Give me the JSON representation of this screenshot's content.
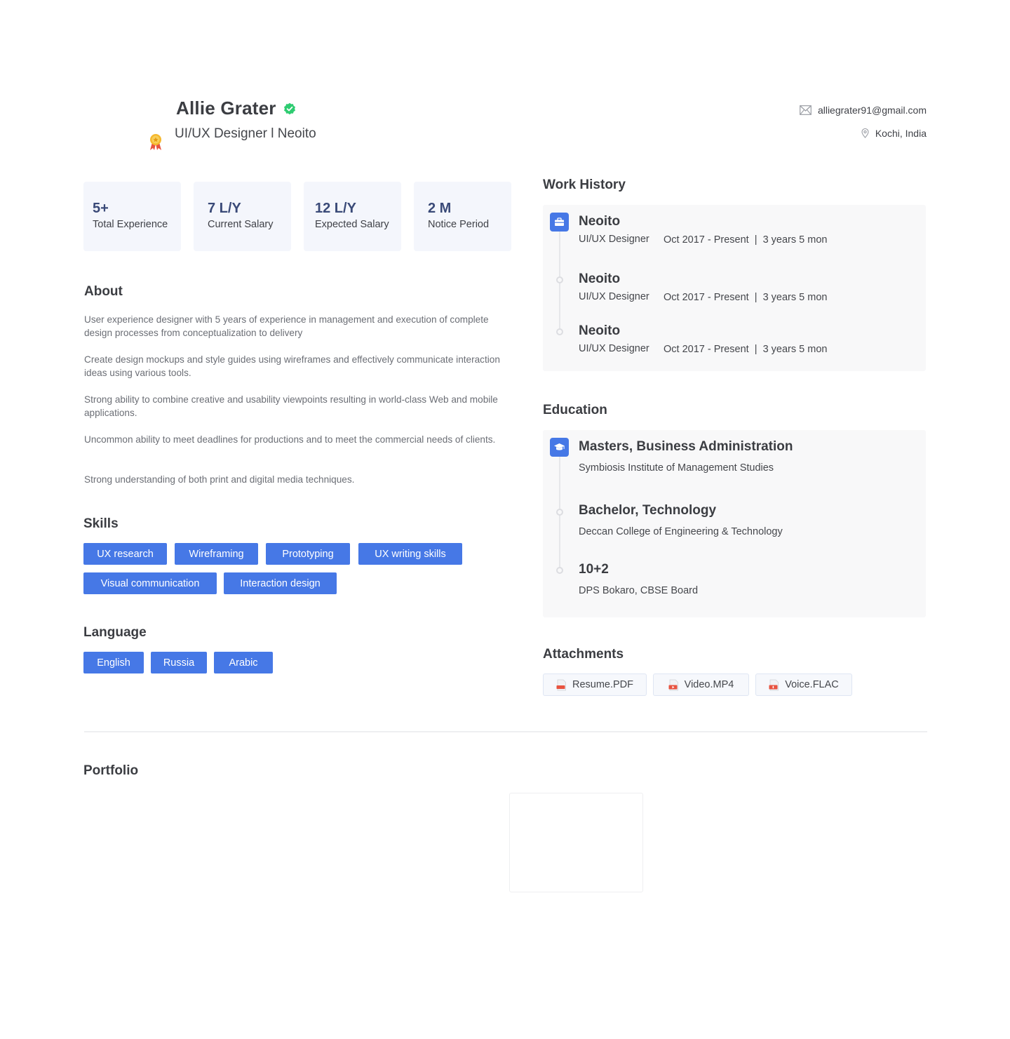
{
  "profile": {
    "name": "Allie Grater",
    "role": "UI/UX Designer l Neoito",
    "email": "alliegrater91@gmail.com",
    "location": "Kochi, India"
  },
  "stats": [
    {
      "value": "5+",
      "label": "Total Experience"
    },
    {
      "value": "7 L/Y",
      "label": "Current Salary"
    },
    {
      "value": "12 L/Y",
      "label": "Expected Salary"
    },
    {
      "value": "2 M",
      "label": "Notice Period"
    }
  ],
  "about": {
    "title": "About",
    "paragraphs": [
      "User experience designer with 5 years of experience in management and execution of complete design processes from conceptualization to delivery",
      "Create design mockups and style guides using wireframes and effectively communicate interaction ideas using various tools.",
      "Strong ability to combine creative and usability viewpoints resulting in world-class Web and mobile applications.",
      "Uncommon ability to meet deadlines for productions and to meet the commercial needs of clients.",
      "Strong understanding of both print and digital media techniques."
    ]
  },
  "skills": {
    "title": "Skills",
    "items": [
      "UX research",
      "Wireframing",
      "Prototyping",
      "UX writing skills",
      "Visual communication",
      "Interaction design"
    ]
  },
  "language": {
    "title": "Language",
    "items": [
      "English",
      "Russia",
      "Arabic"
    ]
  },
  "work_history": {
    "title": "Work History",
    "items": [
      {
        "company": "Neoito",
        "position": "UI/UX Designer",
        "period": "Oct 2017 - Present  |  3 years 5 mon"
      },
      {
        "company": "Neoito",
        "position": "UI/UX Designer",
        "period": "Oct 2017 - Present  |  3 years 5 mon"
      },
      {
        "company": "Neoito",
        "position": "UI/UX Designer",
        "period": "Oct 2017 - Present  |  3 years 5 mon"
      }
    ]
  },
  "education": {
    "title": "Education",
    "items": [
      {
        "degree": "Masters, Business Administration",
        "institution": "Symbiosis Institute of Management Studies"
      },
      {
        "degree": "Bachelor, Technology",
        "institution": "Deccan College of Engineering & Technology"
      },
      {
        "degree": "10+2",
        "institution": "DPS Bokaro, CBSE Board"
      }
    ]
  },
  "attachments": {
    "title": "Attachments",
    "items": [
      {
        "name": "Resume.PDF",
        "icon": "pdf-file-icon"
      },
      {
        "name": "Video.MP4",
        "icon": "video-file-icon"
      },
      {
        "name": "Voice.FLAC",
        "icon": "audio-file-icon"
      }
    ]
  },
  "portfolio": {
    "title": "Portfolio"
  },
  "colors": {
    "accent": "#4678e6",
    "verified": "#2ecc71",
    "stat_bg": "#f4f6fc",
    "stat_value": "#3a4a78",
    "file_red": "#e8533f"
  }
}
